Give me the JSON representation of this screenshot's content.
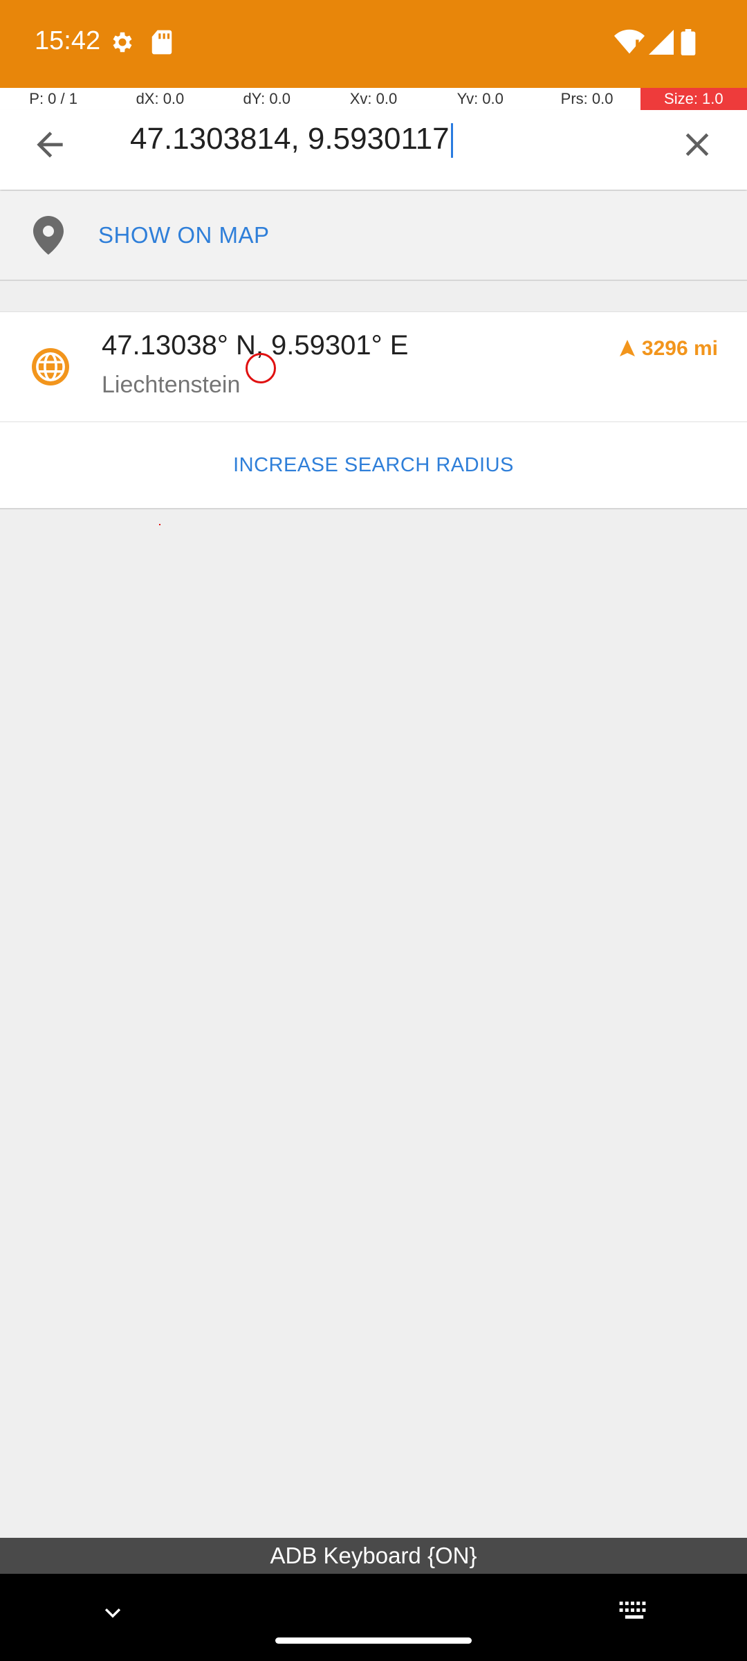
{
  "status_bar": {
    "time": "15:42",
    "icons": [
      "settings-gear-icon",
      "sd-card-icon",
      "wifi-icon",
      "signal-icon",
      "battery-icon"
    ],
    "background": "#e8860a"
  },
  "pointer_overlay": {
    "p": "P: 0 / 1",
    "dx": "dX: 0.0",
    "dy": "dY: 0.0",
    "xv": "Xv: 0.0",
    "yv": "Yv: 0.0",
    "prs": "Prs: 0.0",
    "size": "Size: 1.0"
  },
  "search": {
    "query": "47.1303814, 9.5930117"
  },
  "show_on_map": {
    "label": "SHOW ON MAP"
  },
  "result": {
    "title": "47.13038° N, 9.59301° E",
    "subtitle": "Liechtenstein",
    "distance": "3296 mi"
  },
  "increase_radius": {
    "label": "INCREASE SEARCH RADIUS"
  },
  "keyboard_banner": {
    "label": "ADB Keyboard {ON}"
  },
  "colors": {
    "accent_blue": "#2f7fd9",
    "accent_orange": "#f2951c"
  }
}
